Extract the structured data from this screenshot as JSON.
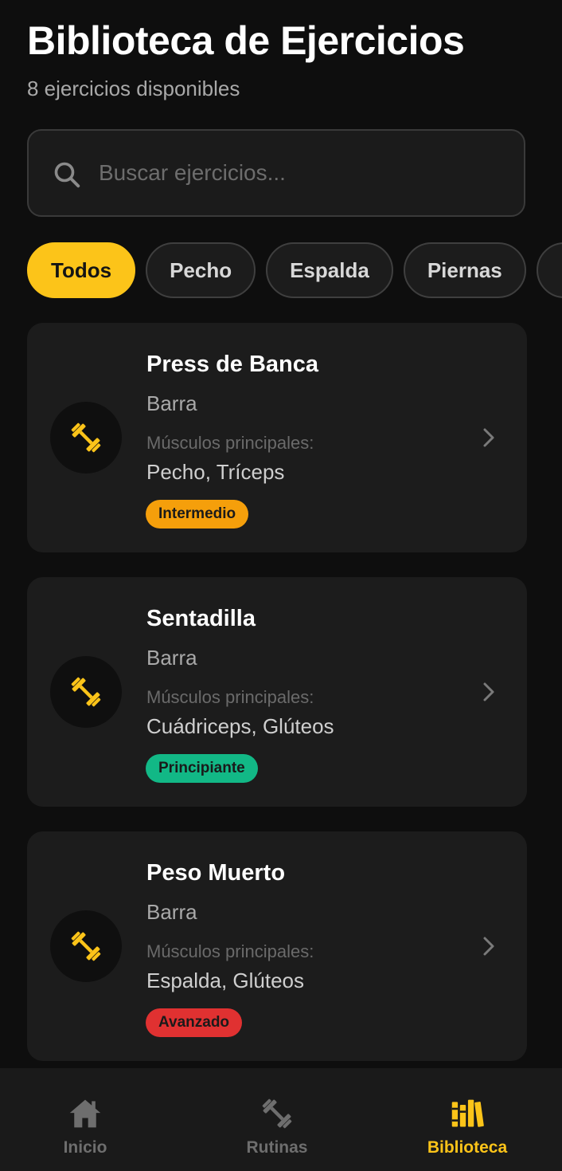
{
  "header": {
    "title": "Biblioteca de Ejercicios",
    "subtitle": "8 ejercicios disponibles"
  },
  "search": {
    "placeholder": "Buscar ejercicios...",
    "value": "",
    "icon": "search-icon"
  },
  "filters": [
    {
      "label": "Todos",
      "active": true
    },
    {
      "label": "Pecho",
      "active": false
    },
    {
      "label": "Espalda",
      "active": false
    },
    {
      "label": "Piernas",
      "active": false
    }
  ],
  "muscles_label": "Músculos principales:",
  "exercises": [
    {
      "name": "Press de Banca",
      "equipment": "Barra",
      "muscles": "Pecho, Tríceps",
      "level": "Intermedio",
      "level_color": "#f59f0b",
      "icon": "dumbbell-icon"
    },
    {
      "name": "Sentadilla",
      "equipment": "Barra",
      "muscles": "Cuádriceps, Glúteos",
      "level": "Principiante",
      "level_color": "#12b886",
      "icon": "dumbbell-icon"
    },
    {
      "name": "Peso Muerto",
      "equipment": "Barra",
      "muscles": "Espalda, Glúteos",
      "level": "Avanzado",
      "level_color": "#e03131",
      "icon": "dumbbell-icon"
    }
  ],
  "bottom_nav": [
    {
      "label": "Inicio",
      "icon": "home-icon",
      "active": false
    },
    {
      "label": "Rutinas",
      "icon": "dumbbell-icon",
      "active": false
    },
    {
      "label": "Biblioteca",
      "icon": "library-icon",
      "active": true
    }
  ],
  "colors": {
    "accent": "#fcc419",
    "background": "#0e0e0e",
    "card": "#1c1c1c"
  }
}
